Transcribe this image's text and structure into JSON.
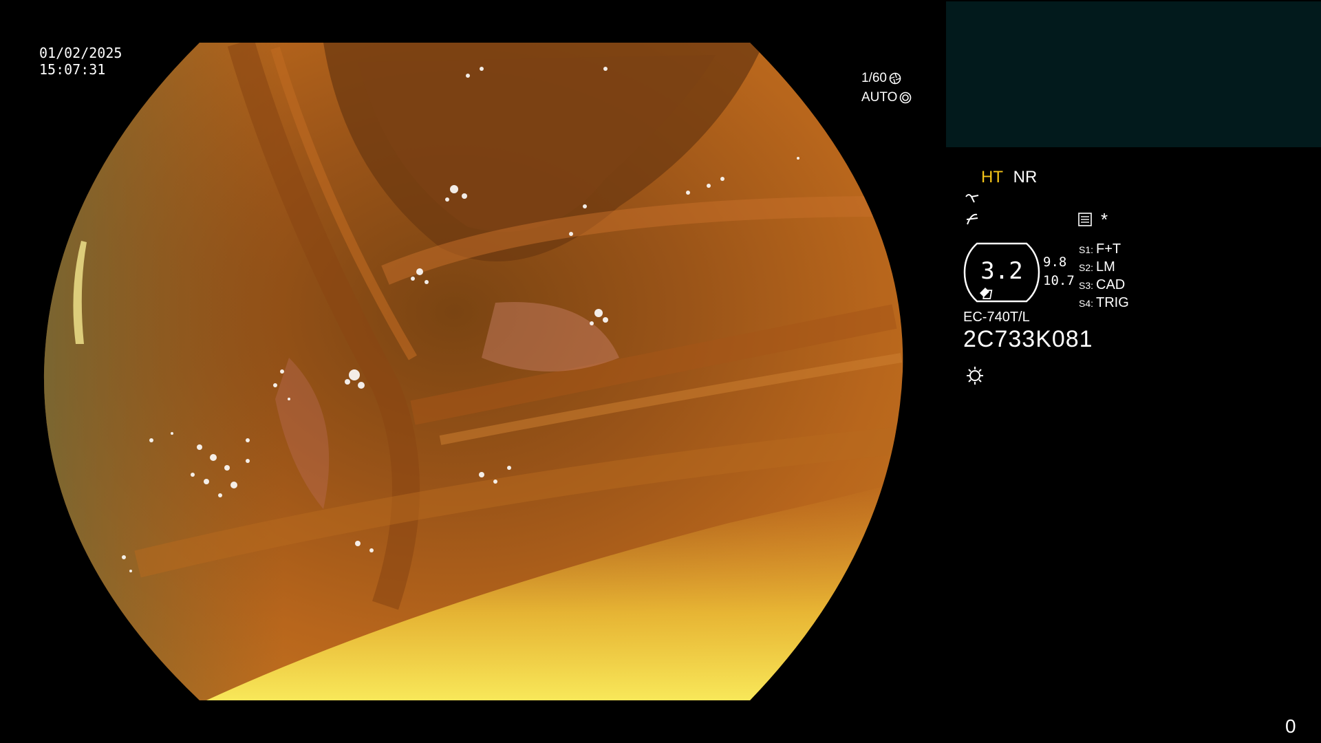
{
  "overlay": {
    "date": "01/02/2025",
    "time": "15:07:31",
    "shutter_speed": "1/60",
    "iris_mode": "AUTO"
  },
  "icons": {
    "shutter": "shutter-icon",
    "iris": "iris-icon",
    "enhancement": "enhancement-icon",
    "structure": "structure-icon",
    "settings": "settings-list-icon",
    "light": "light-source-icon"
  },
  "panel": {
    "ht_label": "HT",
    "nr_label": "NR",
    "asterisk": "*",
    "ring_value": "3.2",
    "side_value_1": "9.8",
    "side_value_2": "10.7",
    "switches": [
      {
        "key": "S1:",
        "value": "F+T"
      },
      {
        "key": "S2:",
        "value": "LM"
      },
      {
        "key": "S3:",
        "value": "CAD"
      },
      {
        "key": "S4:",
        "value": "TRIG"
      }
    ],
    "model": "EC-740T/L",
    "serial": "2C733K081"
  },
  "counter": "0",
  "colors": {
    "ht": "#f5c518",
    "thumbnail_bg": "#021a1c",
    "background": "#000000"
  }
}
